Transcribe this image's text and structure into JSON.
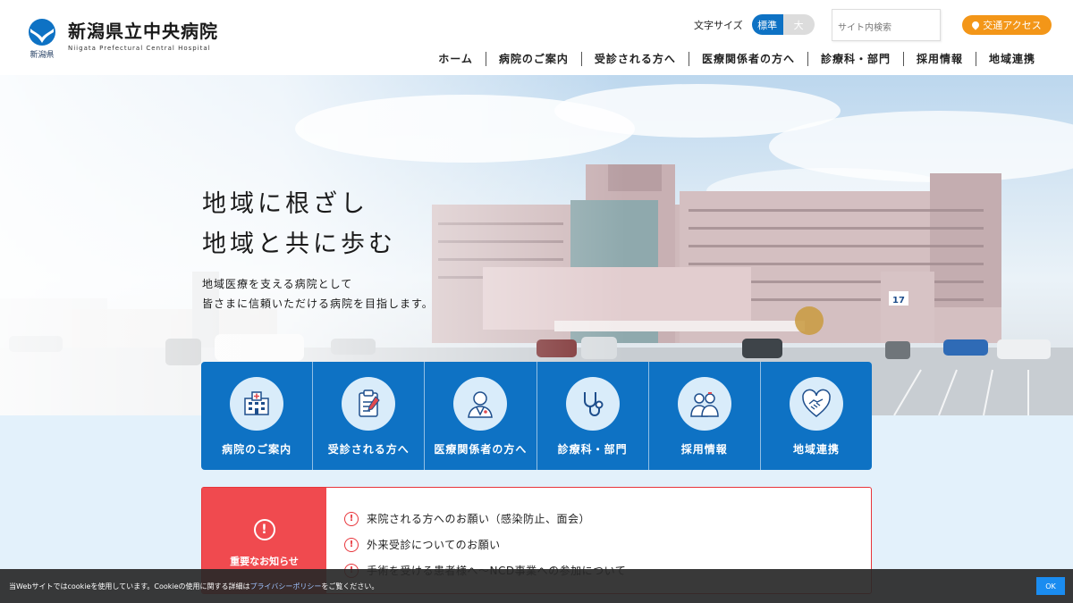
{
  "header": {
    "logo_pref": "新潟県",
    "logo_title": "新潟県立中央病院",
    "logo_sub": "Niigata Prefectural Central Hospital",
    "font_size_label": "文字サイズ",
    "font_size_standard": "標準",
    "font_size_large": "大",
    "search_placeholder": "サイト内検索",
    "access_label": "交通アクセス",
    "nav": [
      {
        "label": "ホーム"
      },
      {
        "label": "病院のご案内"
      },
      {
        "label": "受診される方へ"
      },
      {
        "label": "医療関係者の方へ"
      },
      {
        "label": "診療科・部門"
      },
      {
        "label": "採用情報"
      },
      {
        "label": "地域連携"
      }
    ]
  },
  "hero": {
    "title_line1": "地域に根ざし",
    "title_line2": "地域と共に歩む",
    "lead_line1": "地域医療を支える病院として",
    "lead_line2": "皆さまに信頼いただける病院を目指します。",
    "building_sign_number": "17"
  },
  "tiles": [
    {
      "label": "病院のご案内",
      "icon": "hospital-building-icon"
    },
    {
      "label": "受診される方へ",
      "icon": "clipboard-icon"
    },
    {
      "label": "医療関係者の方へ",
      "icon": "doctor-icon"
    },
    {
      "label": "診療科・部門",
      "icon": "stethoscope-icon"
    },
    {
      "label": "採用情報",
      "icon": "staff-icon"
    },
    {
      "label": "地域連携",
      "icon": "handshake-heart-icon"
    }
  ],
  "notice": {
    "heading": "重要なお知らせ",
    "items": [
      {
        "text": "来院される方へのお願い（感染防止、面会）"
      },
      {
        "text": "外来受診についてのお願い"
      },
      {
        "text": "手術を受ける患者様へ〜NCD事業への参加について"
      }
    ]
  },
  "cookie": {
    "text_before": "当Webサイトではcookieを使用しています。Cookieの使用に関する詳細は",
    "link": "プライバシーポリシー",
    "text_after": "をご覧ください。",
    "ok_label": "OK"
  },
  "colors": {
    "brand_blue": "#0e72c4",
    "access_orange": "#f39618",
    "alert_red": "#e8353b"
  }
}
